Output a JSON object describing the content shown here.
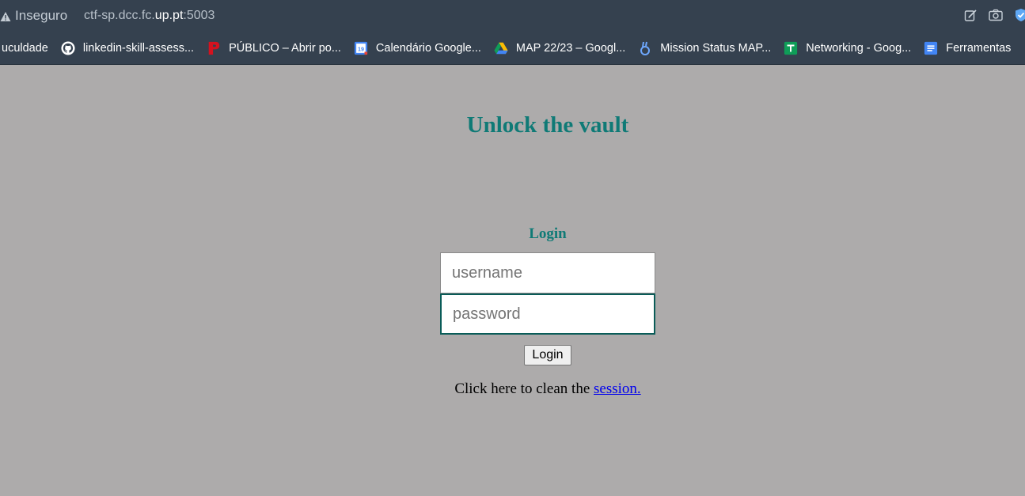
{
  "browser": {
    "security_label": "Inseguro",
    "url": {
      "prefix": "ctf-sp.dcc.fc.",
      "host": "up.pt",
      "port": ":5003"
    },
    "actions": [
      "edit-icon",
      "camera-icon",
      "shield-check-icon"
    ]
  },
  "bookmarks": [
    {
      "label": "uculdade",
      "icon": "none"
    },
    {
      "label": "linkedin-skill-assess...",
      "icon": "github-icon"
    },
    {
      "label": "PÚBLICO – Abrir po...",
      "icon": "publico-icon"
    },
    {
      "label": "Calendário Google...",
      "icon": "google-calendar-icon"
    },
    {
      "label": "MAP 22/23 – Googl...",
      "icon": "google-drive-icon"
    },
    {
      "label": "Mission Status MAP...",
      "icon": "mission-status-icon"
    },
    {
      "label": "Networking - Goog...",
      "icon": "google-sheets-icon"
    },
    {
      "label": "Ferramentas",
      "icon": "google-docs-icon"
    }
  ],
  "page": {
    "title": "Unlock the vault",
    "login_heading": "Login",
    "username_placeholder": "username",
    "password_placeholder": "password",
    "login_button": "Login",
    "clean_text": "Click here to clean the ",
    "session_link": "session."
  },
  "colors": {
    "page_background": "#adabab",
    "heading": "#0f7a76",
    "browser_chrome": "#35414f",
    "link": "#0000ee"
  }
}
